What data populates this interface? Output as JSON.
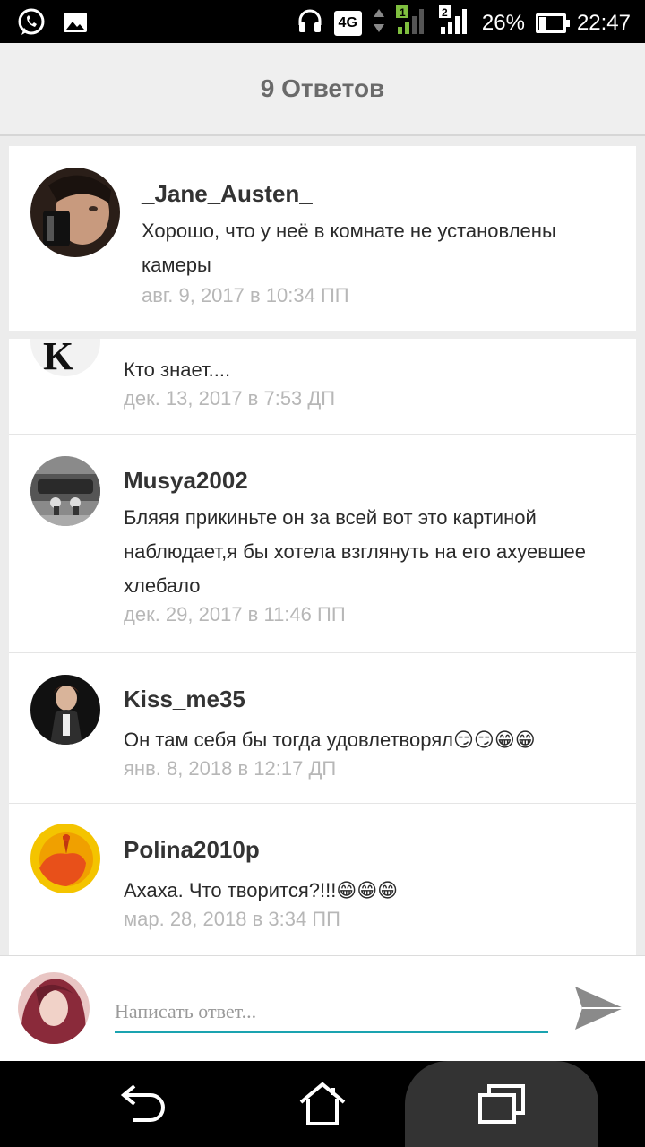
{
  "statusbar": {
    "network_type": "4G",
    "sim1": "1",
    "sim2": "2",
    "battery": "26%",
    "time": "22:47",
    "icons": [
      "whatsapp-icon",
      "gallery-icon",
      "headphones-icon",
      "signal-icon",
      "battery-icon"
    ]
  },
  "header": {
    "title": "9 Ответов"
  },
  "comments": [
    {
      "author": "_Jane_Austen_",
      "text": "Хорошо, что у неё в комнате не установлены камеры",
      "date": "авг. 9, 2017 в 10:34 ПП"
    },
    {
      "author": "",
      "text": "Кто знает....",
      "date": "дек. 13, 2017 в 7:53 ДП"
    },
    {
      "author": "Musya2002",
      "text": "Бляяя прикиньте он за всей вот это картиной наблюдает,я бы хотела взглянуть на его ахуевшее хлебало",
      "date": "дек. 29, 2017 в 11:46 ПП"
    },
    {
      "author": "Kiss_me35",
      "text": "Он там себя бы тогда удовлетворял😏😏😁😁",
      "date": "янв. 8, 2018 в 12:17 ДП"
    },
    {
      "author": "Polina2010p",
      "text": "Ахаха. Что творится?!!!😁😁😁",
      "date": "мар. 28, 2018 в 3:34 ПП"
    }
  ],
  "reply": {
    "placeholder": "Написать ответ..."
  },
  "colors": {
    "accent": "#1aa3b0",
    "date": "#b7b7b7"
  }
}
